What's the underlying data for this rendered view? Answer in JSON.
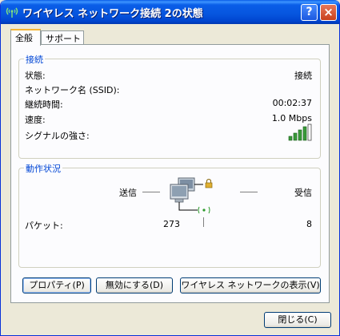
{
  "window": {
    "title": "ワイヤレス ネットワーク接続 2の状態",
    "help_label": "?",
    "close_label": "×"
  },
  "tabs": [
    {
      "label": "全般",
      "active": true
    },
    {
      "label": "サポート",
      "active": false
    }
  ],
  "connection": {
    "group_title": "接続",
    "rows": [
      {
        "label": "状態:",
        "value": "接続"
      },
      {
        "label": "ネットワーク名 (SSID):",
        "value": ""
      },
      {
        "label": "継続時間:",
        "value": "00:02:37"
      },
      {
        "label": "速度:",
        "value": "1.0 Mbps"
      },
      {
        "label": "シグナルの強さ:",
        "value": ""
      }
    ],
    "signal_bars": 4,
    "signal_bars_total": 5
  },
  "activity": {
    "group_title": "動作状況",
    "sent_label": "送信",
    "received_label": "受信",
    "packets_label": "パケット:",
    "packets_sent": "273",
    "packets_received": "8"
  },
  "buttons": {
    "properties": "プロパティ(P)",
    "disable": "無効にする(D)",
    "view_networks": "ワイヤレス ネットワークの表示(V)",
    "close": "閉じる(C)"
  },
  "colors": {
    "titlebar": "#0a5ee8",
    "group_title": "#0046d5",
    "signal": "#3a9a3a"
  }
}
